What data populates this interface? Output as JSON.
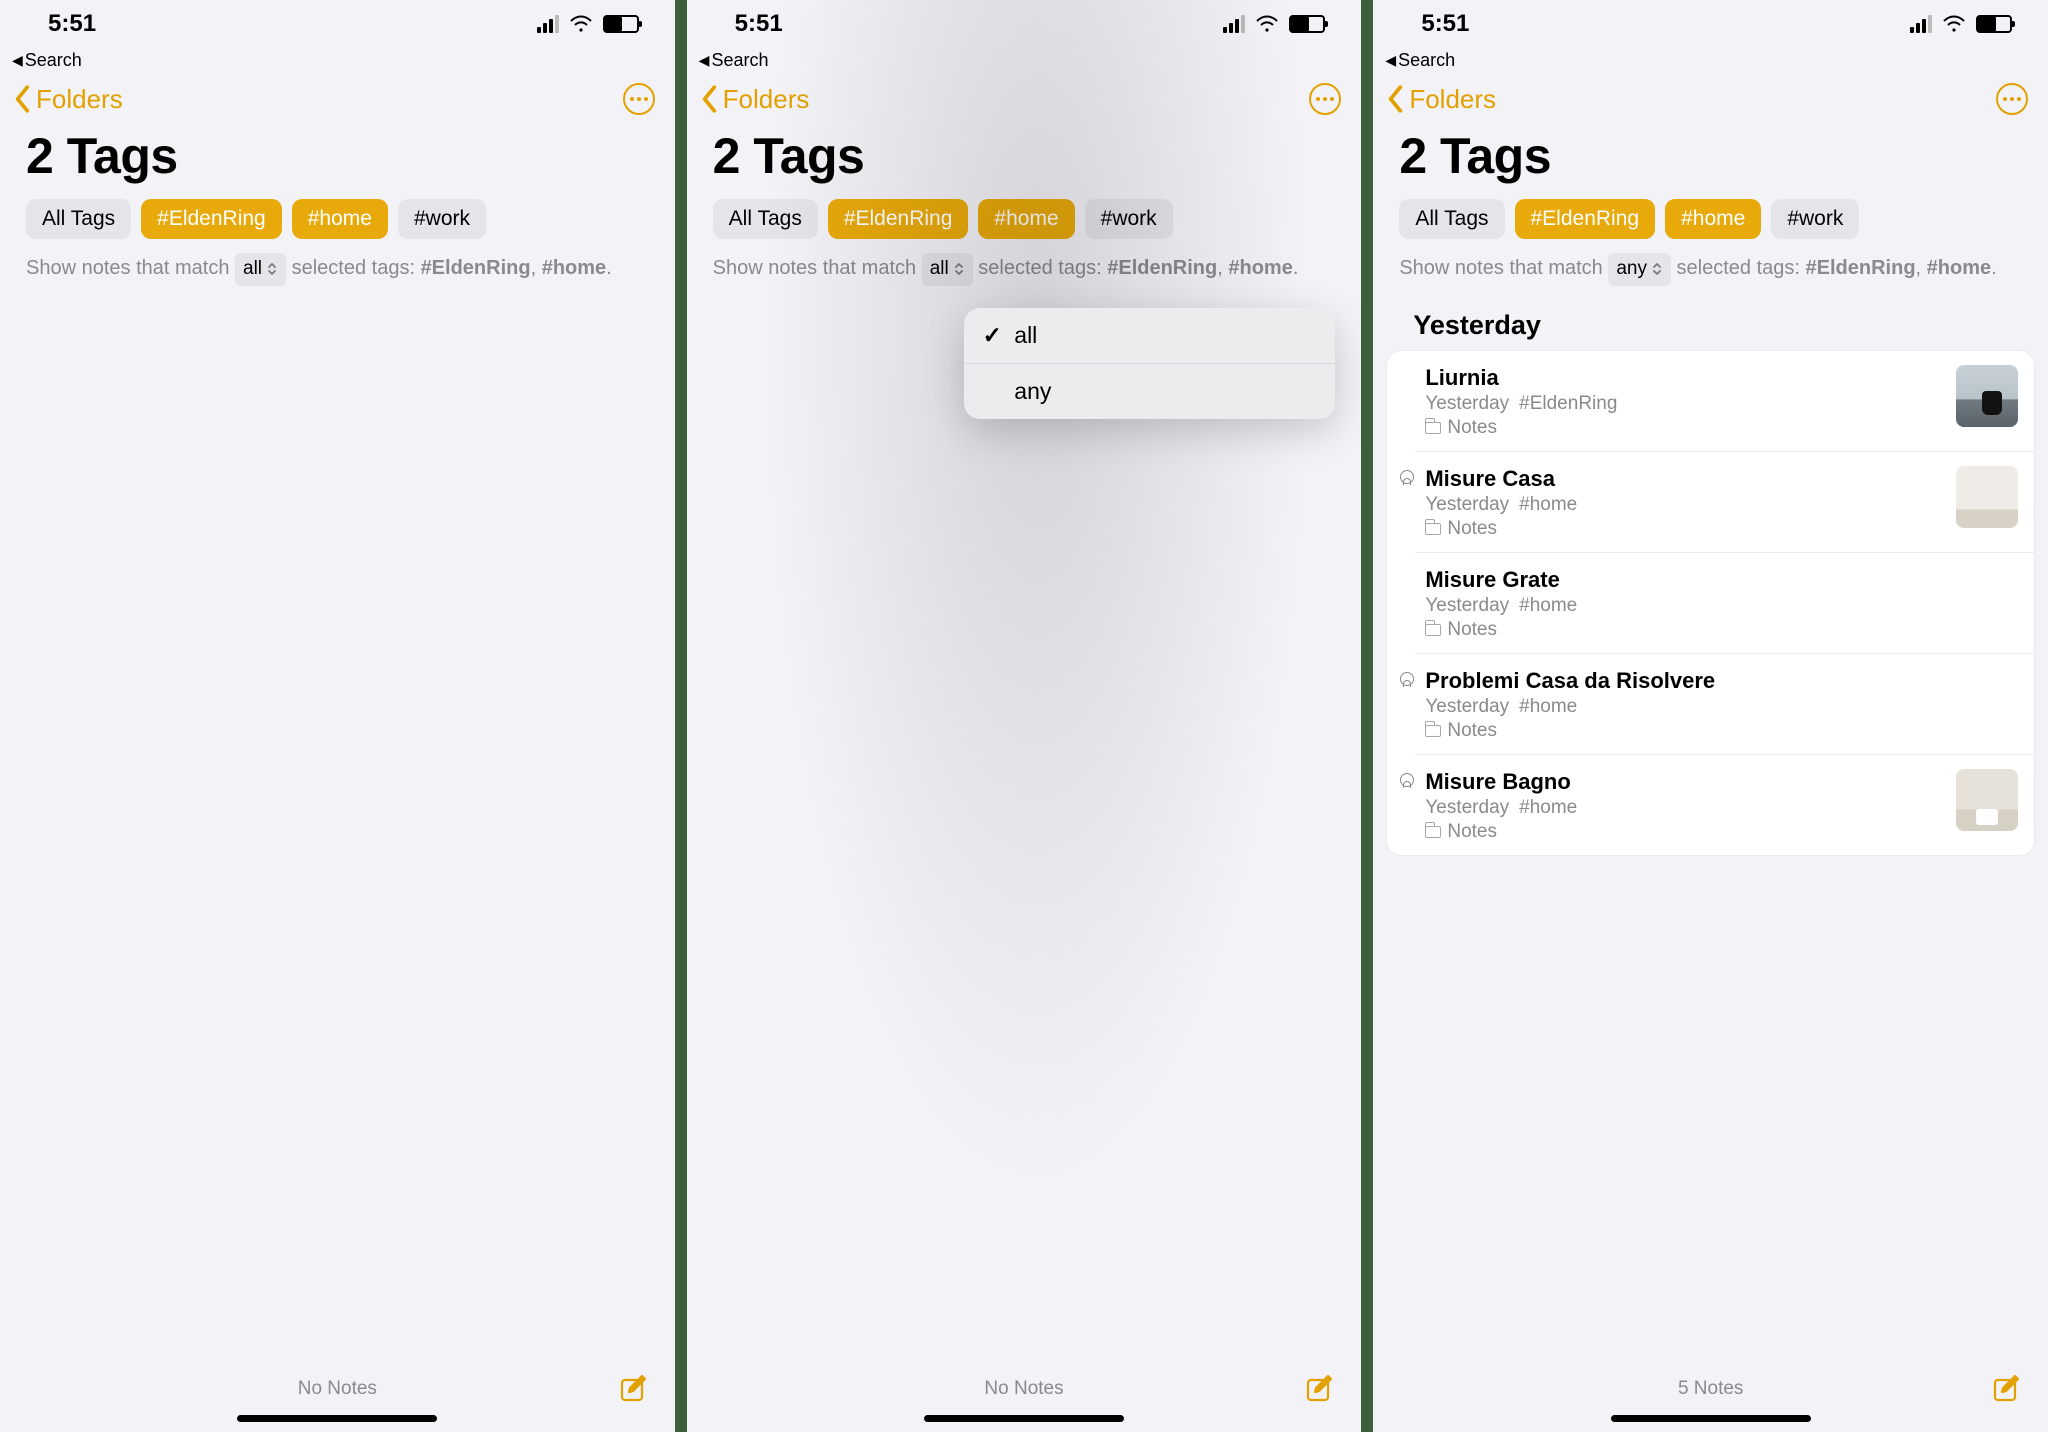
{
  "status": {
    "time": "5:51"
  },
  "back_row": {
    "label": "Search"
  },
  "nav": {
    "back_label": "Folders"
  },
  "title": "2 Tags",
  "screens": [
    {
      "tags": [
        {
          "label": "All Tags",
          "active": false
        },
        {
          "label": "#EldenRing",
          "active": true
        },
        {
          "label": "#home",
          "active": true
        },
        {
          "label": "#work",
          "active": false
        }
      ],
      "filter": {
        "prefix": "Show notes that match",
        "selector": "all",
        "suffix": "selected tags:",
        "tags": [
          "#EldenRing",
          "#home"
        ]
      },
      "dropdown_open": false,
      "notes": null,
      "footer_count": "No Notes"
    },
    {
      "tags": [
        {
          "label": "All Tags",
          "active": false
        },
        {
          "label": "#EldenRing",
          "active": true
        },
        {
          "label": "#home",
          "active": true
        },
        {
          "label": "#work",
          "active": false
        }
      ],
      "filter": {
        "prefix": "Show notes that match",
        "selector": "all",
        "suffix": "selected tags:",
        "tags": [
          "#EldenRing",
          "#home"
        ]
      },
      "dropdown_open": true,
      "dropdown": {
        "options": [
          "all",
          "any"
        ],
        "checked": "all"
      },
      "notes": null,
      "footer_count": "No Notes"
    },
    {
      "tags": [
        {
          "label": "All Tags",
          "active": false
        },
        {
          "label": "#EldenRing",
          "active": true
        },
        {
          "label": "#home",
          "active": true
        },
        {
          "label": "#work",
          "active": false
        }
      ],
      "filter": {
        "prefix": "Show notes that match",
        "selector": "any",
        "suffix": "selected tags:",
        "tags": [
          "#EldenRing",
          "#home"
        ]
      },
      "dropdown_open": false,
      "section_header": "Yesterday",
      "notes": [
        {
          "title": "Liurnia",
          "date": "Yesterday",
          "tag": "#EldenRing",
          "folder": "Notes",
          "shared": false,
          "thumb": "a"
        },
        {
          "title": "Misure Casa",
          "date": "Yesterday",
          "tag": "#home",
          "folder": "Notes",
          "shared": true,
          "thumb": "b"
        },
        {
          "title": "Misure Grate",
          "date": "Yesterday",
          "tag": "#home",
          "folder": "Notes",
          "shared": false,
          "thumb": null
        },
        {
          "title": "Problemi Casa da Risolvere",
          "date": "Yesterday",
          "tag": "#home",
          "folder": "Notes",
          "shared": true,
          "thumb": null
        },
        {
          "title": "Misure Bagno",
          "date": "Yesterday",
          "tag": "#home",
          "folder": "Notes",
          "shared": true,
          "thumb": "c"
        }
      ],
      "footer_count": "5 Notes"
    }
  ]
}
